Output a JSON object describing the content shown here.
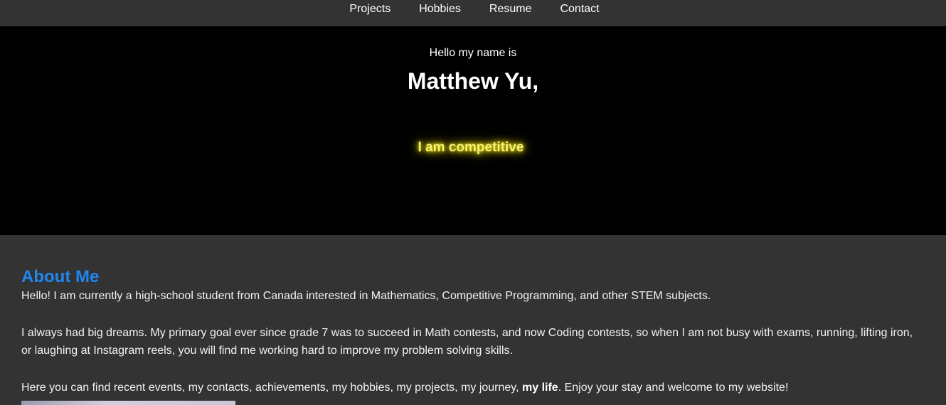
{
  "nav": {
    "items": [
      "Projects",
      "Hobbies",
      "Resume",
      "Contact"
    ]
  },
  "hero": {
    "intro": "Hello my name is",
    "name": "Matthew Yu,",
    "tagline": "I am competitive"
  },
  "about": {
    "heading": "About Me",
    "paragraph1": "Hello! I am currently a high-school student from Canada interested in Mathematics, Competitive Programming, and other STEM subjects.",
    "paragraph2": "I always had big dreams. My primary goal ever since grade 7 was to succeed in Math contests, and now Coding contests, so when I am not busy with exams, running, lifting iron, or laughing at Instagram reels, you will find me working hard to improve my problem solving skills.",
    "paragraph3_before": "Here you can find recent events, my contacts, achievements, my hobbies, my projects, my journey, ",
    "paragraph3_bold": "my life",
    "paragraph3_after": ". Enjoy your stay and welcome to my website!"
  },
  "colors": {
    "background": "#333333",
    "hero_background": "#000000",
    "heading_blue": "#1e88f0",
    "glow_yellow": "#fff600"
  }
}
